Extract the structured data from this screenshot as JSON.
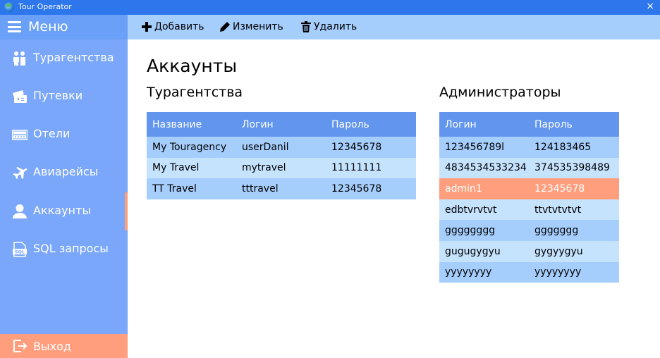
{
  "window": {
    "title": "Tour Operator",
    "close_glyph": "×"
  },
  "sidebar": {
    "menu_label": "Меню",
    "items": [
      {
        "label": "Турагентства",
        "icon": "travel-agents-icon"
      },
      {
        "label": "Путевки",
        "icon": "tickets-icon"
      },
      {
        "label": "Отели",
        "icon": "hotel-icon"
      },
      {
        "label": "Авиарейсы",
        "icon": "airplane-icon"
      },
      {
        "label": "Аккаунты",
        "icon": "user-icon",
        "active": true
      },
      {
        "label": "SQL запросы",
        "icon": "sql-file-icon"
      }
    ],
    "logout_label": "Выход"
  },
  "toolbar": {
    "add_label": "Добавить",
    "edit_label": "Изменить",
    "delete_label": "Удалить"
  },
  "page": {
    "title": "Аккаунты"
  },
  "agencies": {
    "title": "Турагентства",
    "columns": [
      "Название",
      "Логин",
      "Пароль"
    ],
    "rows": [
      [
        "My Touragency",
        "userDanil",
        "12345678"
      ],
      [
        "My Travel",
        "mytravel",
        "11111111"
      ],
      [
        "TT Travel",
        "tttravel",
        "12345678"
      ]
    ]
  },
  "admins": {
    "title": "Администраторы",
    "columns": [
      "Логин",
      "Пароль"
    ],
    "selected_row": 2,
    "rows": [
      [
        "123456789l",
        "124183465"
      ],
      [
        "4834534533234",
        "374535398489"
      ],
      [
        "admin1",
        "12345678"
      ],
      [
        "edbtvrvtvt",
        "ttvtvtvtvt"
      ],
      [
        "gggggggg",
        "ggggggg"
      ],
      [
        "gugugygyu",
        "gygyygyu"
      ],
      [
        "yyyyyyyy",
        "yyyyyyyy"
      ]
    ]
  },
  "colors": {
    "titlebar": "#2d76ec",
    "sidebar": "#7aa7f9",
    "toolbar": "#a6cefd",
    "table_header": "#6295ee",
    "accent": "#ff9e7d"
  }
}
